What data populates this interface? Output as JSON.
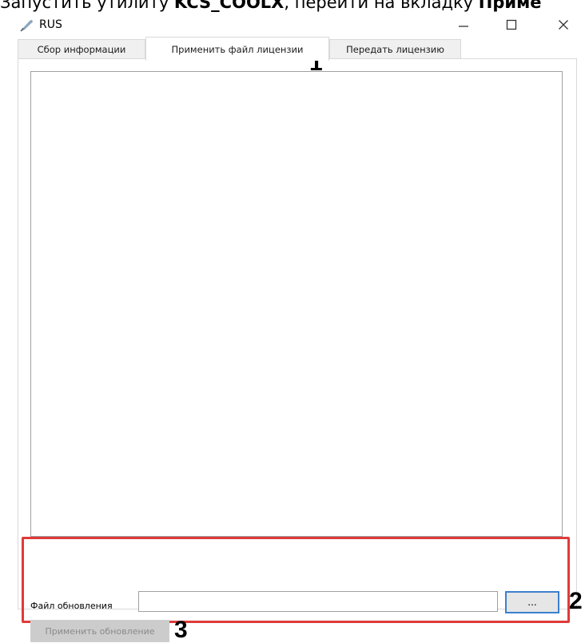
{
  "document": {
    "text_before": "Запустить утилиту ",
    "utility_name": "KCS_COOLX",
    "text_middle": ", перейти на вкладку ",
    "tab_name_fragment": "Приме"
  },
  "window": {
    "title": "RUS",
    "icon": "feather-icon",
    "controls": {
      "minimize": "minimize-icon",
      "maximize": "maximize-icon",
      "close": "close-icon"
    }
  },
  "tabs": [
    {
      "label": "Сбор информации",
      "active": false
    },
    {
      "label": "Применить файл лицензии",
      "active": true
    },
    {
      "label": "Передать лицензию",
      "active": false
    }
  ],
  "form": {
    "file_label": "Файл обновления",
    "file_value": "",
    "browse_label": "...",
    "apply_label": "Применить обновление",
    "apply_enabled": false
  },
  "annotations": {
    "marker_1": "1",
    "marker_2": "2",
    "marker_3": "3"
  },
  "colors": {
    "highlight": "#e03a3a",
    "focus_border": "#3c7fd0",
    "disabled_bg": "#cccccc"
  }
}
